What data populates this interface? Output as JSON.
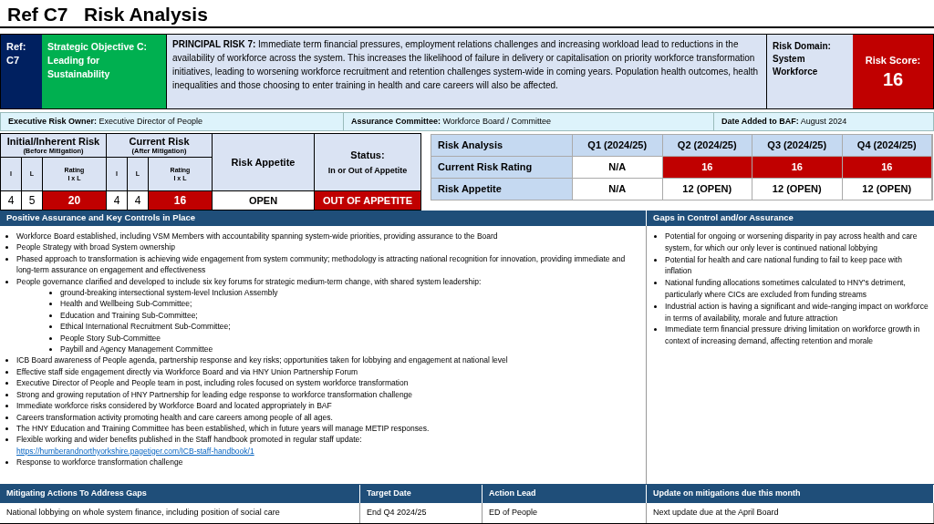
{
  "title": "Ref C7   Risk Analysis",
  "ref": {
    "label": "Ref:",
    "value": "C7"
  },
  "objective": "Strategic Objective C: Leading for Sustainability",
  "principal_risk": {
    "label": "PRINCIPAL RISK 7:",
    "text": "Immediate term financial pressures, employment relations challenges and increasing workload lead to reductions in the availability of workforce across the system. This increases the likelihood of failure in delivery or capitalisation on priority workforce transformation initiatives, leading to worsening workforce recruitment and retention challenges system-wide in coming years. Population health outcomes, health inequalities and those choosing to enter training in health and care careers will also be affected."
  },
  "risk_domain": {
    "label": "Risk Domain:",
    "value": "System Workforce"
  },
  "risk_score": {
    "label": "Risk Score:",
    "value": "16"
  },
  "info_bar": [
    {
      "label": "Executive Risk Owner:",
      "value": "Executive Director of People"
    },
    {
      "label": "Assurance Committee:",
      "value": "Workforce Board /  Committee"
    },
    {
      "label": "Date Added to BAF:",
      "value": "August 2024"
    }
  ],
  "rating_table": {
    "initial": {
      "title": "Initial/Inherent Risk",
      "subtitle": "(Before Mitigation)",
      "i_label": "I",
      "l_label": "L",
      "rating_label": "Rating",
      "rating_sub": "I x L",
      "i": "4",
      "l": "5",
      "rating": "20",
      "alert": true
    },
    "current": {
      "title": "Current Risk",
      "subtitle": "(After Mitigation)",
      "i_label": "I",
      "l_label": "L",
      "rating_label": "Rating",
      "rating_sub": "I x L",
      "i": "4",
      "l": "4",
      "rating": "16",
      "alert": true
    },
    "appetite": {
      "label": "Risk Appetite",
      "value": "OPEN",
      "alert": false
    },
    "status": {
      "label": "Status:",
      "sublabel": "In or Out of Appetite",
      "value": "OUT OF APPETITE",
      "alert": true
    }
  },
  "quarter_table": {
    "columns": [
      "Risk Analysis",
      "Q1 (2024/25)",
      "Q2 (2024/25)",
      "Q3 (2024/25)",
      "Q4 (2024/25)"
    ],
    "rows": [
      {
        "cells": [
          {
            "text": "Current Risk Rating",
            "alert": false
          },
          {
            "text": "N/A",
            "alert": false
          },
          {
            "text": "16",
            "alert": true
          },
          {
            "text": "16",
            "alert": true
          },
          {
            "text": "16",
            "alert": true
          }
        ]
      },
      {
        "cells": [
          {
            "text": "Risk Appetite",
            "alert": false
          },
          {
            "text": "N/A",
            "alert": false
          },
          {
            "text": "12 (OPEN)",
            "alert": false
          },
          {
            "text": "12 (OPEN)",
            "alert": false
          },
          {
            "text": "12 (OPEN)",
            "alert": false
          }
        ]
      }
    ]
  },
  "controls": {
    "title": "Positive Assurance and Key Controls in Place",
    "items": [
      {
        "text": "Workforce Board established, including VSM Members with accountability spanning system-wide priorities, providing assurance to the Board"
      },
      {
        "text": "People Strategy with broad System ownership"
      },
      {
        "text": "Phased approach to transformation is achieving wide engagement from system community; methodology is attracting national recognition for innovation, providing immediate and long-term assurance on engagement and effectiveness"
      },
      {
        "text": "People governance clarified and developed to include six key forums for strategic medium-term change, with shared system leadership:",
        "children": [
          "ground-breaking intersectional system-level Inclusion Assembly",
          "Health and Wellbeing Sub-Committee;",
          "Education and Training Sub-Committee;",
          "Ethical International Recruitment Sub-Committee;",
          "People Story Sub-Committee",
          "Paybill and Agency Management Committee"
        ]
      },
      {
        "text": "ICB Board awareness of People agenda, partnership response and key risks; opportunities taken for lobbying and engagement at national level"
      },
      {
        "text": "Effective staff side engagement directly via Workforce Board and via HNY Union Partnership Forum"
      },
      {
        "text": "Executive Director of People and People team in post, including roles focused on system workforce transformation"
      },
      {
        "text": "Strong and growing reputation of HNY Partnership for leading edge response to workforce transformation challenge"
      },
      {
        "text": "Immediate workforce risks considered by Workforce Board and located appropriately in BAF"
      },
      {
        "text": "Careers transformation activity promoting health and care careers among people of all ages."
      },
      {
        "text": "The HNY Education and Training Committee has been established, which in future years will manage METIP responses."
      },
      {
        "text": "Flexible working and wider benefits published in the Staff handbook promoted in regular staff update:",
        "link": "https://humberandnorthyorkshire.pagetiger.com/ICB-staff-handbook/1"
      },
      {
        "text": "Response to workforce transformation challenge"
      }
    ]
  },
  "gaps": {
    "title": "Gaps in Control and/or Assurance",
    "items": [
      "Potential for ongoing or worsening disparity in pay across health and care system, for which our only lever is continued national lobbying",
      "Potential for health and care national funding to fail to keep pace with inflation",
      "National funding allocations sometimes calculated to HNY's detriment, particularly where CICs are excluded from funding streams",
      "Industrial action is having a significant and wide-ranging impact on workforce in terms of availability, morale and future attraction",
      "Immediate term financial pressure driving limitation on workforce growth in context of increasing demand, affecting retention and morale"
    ]
  },
  "actions_table": {
    "columns": [
      "Mitigating Actions To Address Gaps",
      "Target Date",
      "Action Lead",
      "Update on mitigations due this month"
    ],
    "rows": [
      [
        "National lobbying on whole system finance, including position of social care",
        "End Q4 2024/25",
        "ED of People",
        "Next update due at the April Board"
      ]
    ]
  }
}
